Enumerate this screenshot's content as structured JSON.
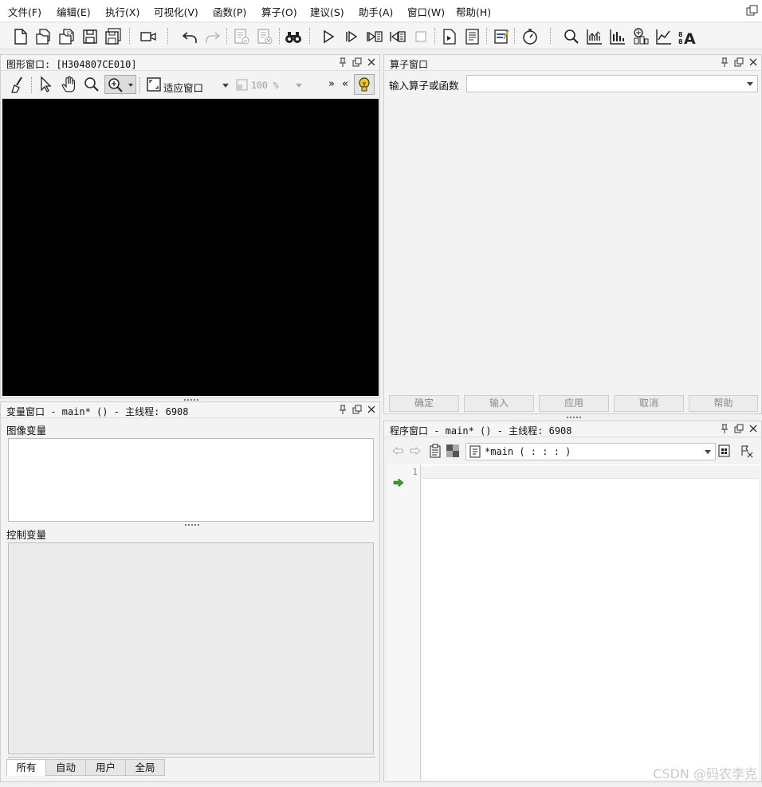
{
  "menubar": {
    "items": [
      "文件(F)",
      "编辑(E)",
      "执行(X)",
      "可视化(V)",
      "函数(P)",
      "算子(O)",
      "建议(S)",
      "助手(A)",
      "窗口(W)",
      "帮助(H)"
    ]
  },
  "toolbar": {
    "icons": [
      "new-file-icon",
      "open-file-icon",
      "open-example-icon",
      "save-icon",
      "save-all-icon",
      "record-icon",
      "undo-icon",
      "redo-icon",
      "activate-icon",
      "deactivate-icon",
      "find-icon",
      "run-icon",
      "step-over-icon",
      "step-into-icon",
      "step-out-icon",
      "stop-icon",
      "insert-code-icon",
      "procedure-icon",
      "assistant-icon",
      "profiler-icon",
      "zoom-icon",
      "histogram-icon",
      "line-profile-icon",
      "feature-inspection-icon",
      "gray-histogram-icon",
      "ocr-icon"
    ]
  },
  "graphics_window": {
    "title": "图形窗口: [H304807CE010]",
    "fit_window": "适应窗口",
    "zoom_value": "100 %",
    "more_left": "»",
    "more_right": "«"
  },
  "operator_window": {
    "title": "算子窗口",
    "input_label": "输入算子或函数",
    "input_value": "",
    "buttons": [
      "确定",
      "输入",
      "应用",
      "取消",
      "帮助"
    ]
  },
  "variable_window": {
    "title": "变量窗口 - main* () - 主线程: 6908",
    "image_vars_label": "图像变量",
    "control_vars_label": "控制变量",
    "tabs": [
      "所有",
      "自动",
      "用户",
      "全局"
    ],
    "active_tab": "所有"
  },
  "program_window": {
    "title": "程序窗口 - main* () - 主线程: 6908",
    "procedure_select": "*main ( : : : )",
    "line_numbers": [
      "1"
    ]
  },
  "watermark": "CSDN @码农李克"
}
